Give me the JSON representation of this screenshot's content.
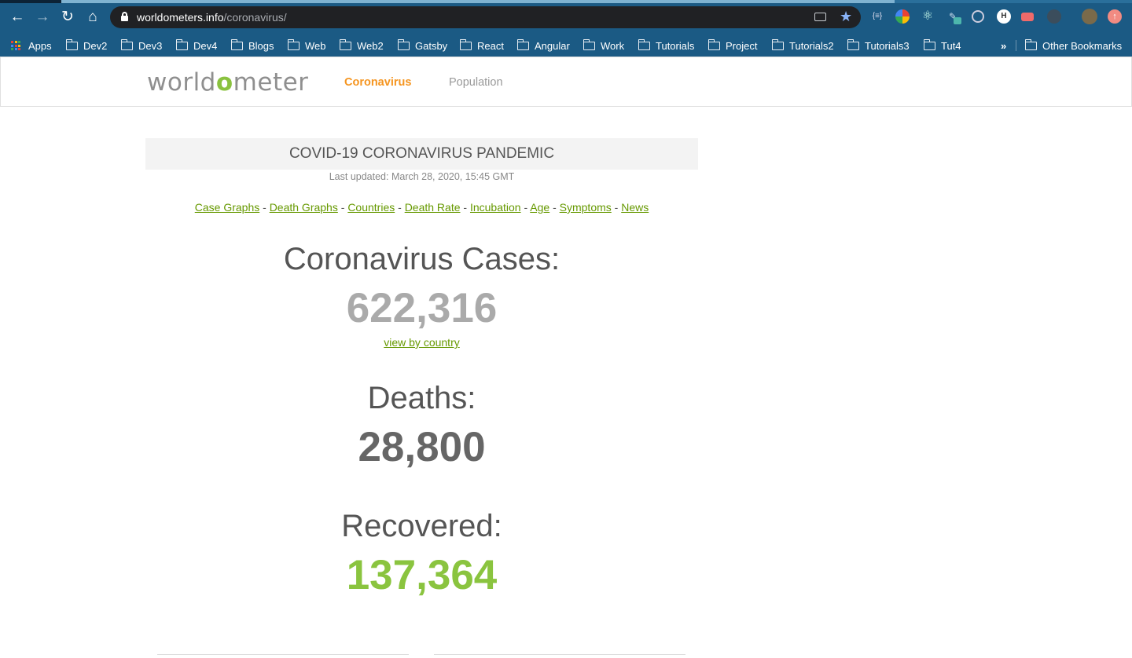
{
  "browser": {
    "url_host": "worldometers.info",
    "url_path": "/coronavirus/",
    "bookmarks": [
      "Dev2",
      "Dev3",
      "Dev4",
      "Blogs",
      "Web",
      "Web2",
      "Gatsby",
      "React",
      "Angular",
      "Work",
      "Tutorials",
      "Project",
      "Tutorials2",
      "Tutorials3",
      "Tut4"
    ],
    "apps_label": "Apps",
    "overflow_label": "»",
    "other_bookmarks": "Other Bookmarks",
    "ext_json_label": "{≡}"
  },
  "site": {
    "logo_before": "world",
    "logo_o": "o",
    "logo_after": "meter",
    "nav": {
      "coronavirus": "Coronavirus",
      "population": "Population"
    },
    "accent_color": "#f59520",
    "green_color": "#8ac43f"
  },
  "main": {
    "title": "COVID-19 CORONAVIRUS PANDEMIC",
    "updated": "Last updated: March 28, 2020, 15:45 GMT",
    "links": [
      "Case Graphs",
      "Death Graphs",
      "Countries",
      "Death Rate",
      "Incubation",
      "Age",
      "Symptoms",
      "News"
    ],
    "link_separator": "-",
    "cases_label": "Coronavirus Cases:",
    "cases_value": "622,316",
    "view_by_country": "view by country",
    "deaths_label": "Deaths:",
    "deaths_value": "28,800",
    "recovered_label": "Recovered:",
    "recovered_value": "137,364"
  }
}
